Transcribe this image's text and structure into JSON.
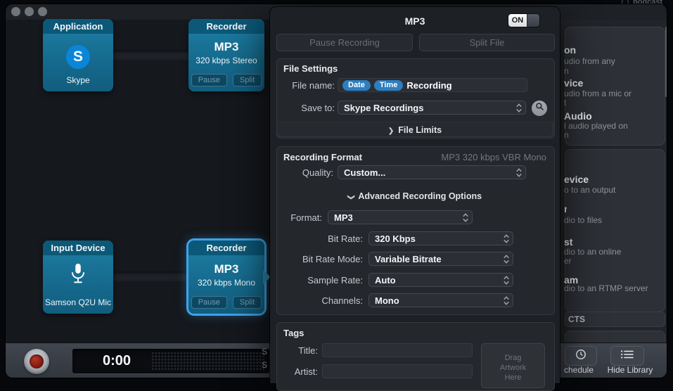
{
  "colors": {
    "block_teal_header": "#0b5878",
    "block_teal_body": "#1d7fa4",
    "selection_blue": "#3fa3ea",
    "token_blue": "#2d7ec0",
    "record_red": "#9e1f14"
  },
  "desktop_fragment": {
    "text": "podcast"
  },
  "canvas": {
    "application_block": {
      "header": "Application",
      "icon_letter": "S",
      "label": "Skype"
    },
    "recorder_block_top": {
      "header": "Recorder",
      "title": "MP3",
      "subtitle": "320 kbps Stereo",
      "pause_label": "Pause",
      "split_label": "Split"
    },
    "input_device_block": {
      "header": "Input Device",
      "label": "Samson Q2U Mic"
    },
    "recorder_block_bottom": {
      "header": "Recorder",
      "title": "MP3",
      "subtitle": "320 kbps Mono",
      "pause_label": "Pause",
      "split_label": "Split",
      "selected": true
    }
  },
  "popover": {
    "title": "MP3",
    "power_toggle": {
      "state": "ON"
    },
    "pause_recording_button": "Pause Recording",
    "split_file_button": "Split File",
    "file_settings": {
      "heading": "File Settings",
      "file_name_label": "File name:",
      "file_name_tokens": [
        "Date",
        "Time"
      ],
      "file_name_text": "Recording",
      "save_to_label": "Save to:",
      "save_to_value": "Skype Recordings",
      "file_limits_label": "File Limits"
    },
    "recording_format": {
      "heading": "Recording Format",
      "summary": "MP3 320 kbps VBR Mono",
      "quality_label": "Quality:",
      "quality_value": "Custom...",
      "advanced_options_label": "Advanced Recording Options",
      "format_label": "Format:",
      "format_value": "MP3",
      "bit_rate_label": "Bit Rate:",
      "bit_rate_value": "320 Kbps",
      "bit_rate_mode_label": "Bit Rate Mode:",
      "bit_rate_mode_value": "Variable Bitrate",
      "sample_rate_label": "Sample Rate:",
      "sample_rate_value": "Auto",
      "channels_label": "Channels:",
      "channels_value": "Mono"
    },
    "tags": {
      "heading": "Tags",
      "title_label": "Title:",
      "artist_label": "Artist:",
      "artwork_placeholder": "Drag Artwork Here"
    }
  },
  "library": {
    "sources_card_fragments": [
      {
        "title": "on",
        "line1": "udio from any",
        "line2": "n"
      },
      {
        "title": "vice",
        "line1": "udio from a mic or",
        "line2": "t"
      },
      {
        "title": "Audio",
        "line1": "l audio played on",
        "line2": "n"
      }
    ],
    "outputs_card_fragments": [
      {
        "title": "evice",
        "line1": "o to an output"
      },
      {
        "title": "r",
        "line1": "dio to files"
      },
      {
        "title": "st",
        "line1": "dio to an online",
        "line2": "er"
      },
      {
        "title": "am",
        "line1": "dio to an RTMP server"
      }
    ],
    "effects_header_fragment": "CTS"
  },
  "footer": {
    "timer": "0:00",
    "clipped_text_top": "S",
    "clipped_text_bottom": "S",
    "schedule_button_label": "chedule",
    "hide_library_button_label": "Hide Library"
  }
}
